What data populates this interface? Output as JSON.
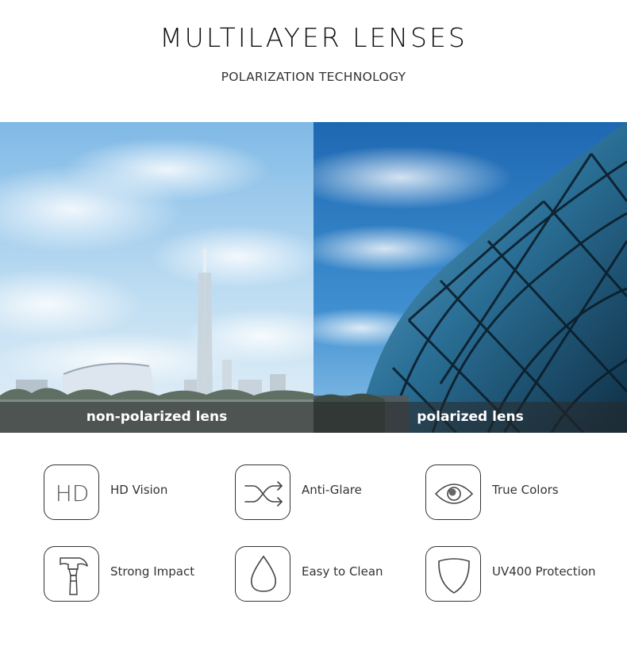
{
  "header": {
    "title": "MULTILAYER LENSES",
    "subtitle": "POLARIZATION TECHNOLOGY"
  },
  "comparison": {
    "left_caption": "non-polarized lens",
    "right_caption": "polarized lens"
  },
  "features": [
    {
      "label": "HD Vision",
      "icon": "hd-icon",
      "icon_text": "HD"
    },
    {
      "label": "Anti-Glare",
      "icon": "shuffle-arrows-icon"
    },
    {
      "label": "True Colors",
      "icon": "eye-icon"
    },
    {
      "label": "Strong Impact",
      "icon": "hammer-icon"
    },
    {
      "label": "Easy to Clean",
      "icon": "water-drop-icon"
    },
    {
      "label": "UV400 Protection",
      "icon": "shield-icon"
    }
  ],
  "colors": {
    "text": "#222222",
    "icon_stroke": "#333333",
    "sky_light": "#cfe6f7",
    "sky_deep": "#1f6fb8",
    "caption_bar": "#282828"
  }
}
